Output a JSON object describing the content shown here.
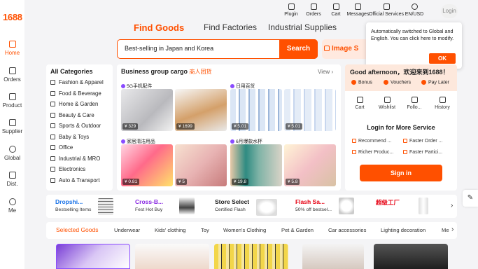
{
  "brand": {
    "logo": "1688"
  },
  "rail": [
    {
      "label": "Home",
      "icon": "home-icon"
    },
    {
      "label": "Orders",
      "icon": "orders-icon"
    },
    {
      "label": "Product",
      "icon": "product-icon"
    },
    {
      "label": "Supplier",
      "icon": "supplier-icon"
    },
    {
      "label": "Global",
      "icon": "globe-icon"
    },
    {
      "label": "Dist.",
      "icon": "distribution-icon"
    },
    {
      "label": "Me",
      "icon": "user-icon"
    }
  ],
  "topbar": [
    {
      "label": "Plugin",
      "icon": "plugin-icon"
    },
    {
      "label": "Orders",
      "icon": "orders-icon"
    },
    {
      "label": "Cart",
      "icon": "cart-icon"
    },
    {
      "label": "Messages",
      "icon": "messages-icon"
    },
    {
      "label": "Official Services",
      "icon": "services-icon"
    },
    {
      "label": "EN/USD",
      "icon": "language-icon"
    }
  ],
  "login_label": "Login",
  "search": {
    "tabs": [
      "Find Goods",
      "Find Factories",
      "Industrial Supplies"
    ],
    "value": "Best-selling in Japan and Korea",
    "button": "Search",
    "image_search": "Image S"
  },
  "popup": {
    "text": "Automatically switched to Global and English. You can click here to modify.",
    "ok": "OK"
  },
  "categories": {
    "title": "All Categories",
    "items": [
      "Fashion & Apparel",
      "Food & Beverage",
      "Home & Garden",
      "Beauty & Care",
      "Sports & Outdoor",
      "Baby & Toys",
      "Office",
      "Industrial & MRO",
      "Electronics",
      "Auto & Transport"
    ]
  },
  "business": {
    "title": "Business group cargo",
    "tag": "商人团货",
    "view": "View",
    "groups": [
      {
        "label": "5G手机配件",
        "prices": [
          "¥ 329",
          "¥ 1699"
        ]
      },
      {
        "label": "日用百货",
        "prices": [
          "¥ 5.01",
          "¥ 5.01"
        ]
      },
      {
        "label": "家居清洁用品",
        "prices": [
          "¥ 0.81",
          "¥ 5"
        ]
      },
      {
        "label": "6月爆款水杯",
        "prices": [
          "¥ 19.8",
          "¥ 5.8"
        ]
      }
    ]
  },
  "account": {
    "greeting": "Good afternoon，欢迎来到1688！",
    "perks": [
      "Bonus",
      "Vouchers",
      "Pay Later"
    ],
    "quick": [
      "Cart",
      "Wishlist",
      "Follo...",
      "History"
    ],
    "login_more": "Login for More Service",
    "services": [
      "Recommend ...",
      "Faster Order ...",
      "Richer Produc...",
      "Faster Partici..."
    ],
    "signin": "Sign in"
  },
  "promo": [
    {
      "title": "Dropshi...",
      "sub": "Bestselling Items",
      "color": "#1a73e8"
    },
    {
      "title": "Cross-B...",
      "sub": "Fest Hot Buy",
      "color": "#8a2be2"
    },
    {
      "title": "Store Select",
      "sub": "Certified Flash",
      "color": "#222222"
    },
    {
      "title": "Flash Sa...",
      "sub": "50% off bestsel...",
      "color": "#e60012"
    },
    {
      "title": "超级工厂",
      "sub": "",
      "color": "#e60012"
    }
  ],
  "goods_tabs": [
    "Selected Goods",
    "Underwear",
    "Kids' clothing",
    "Toy",
    "Women's Clothing",
    "Pet & Garden",
    "Car accessories",
    "Lighting decoration",
    "Me"
  ],
  "colors": {
    "accent": "#ff5000"
  }
}
